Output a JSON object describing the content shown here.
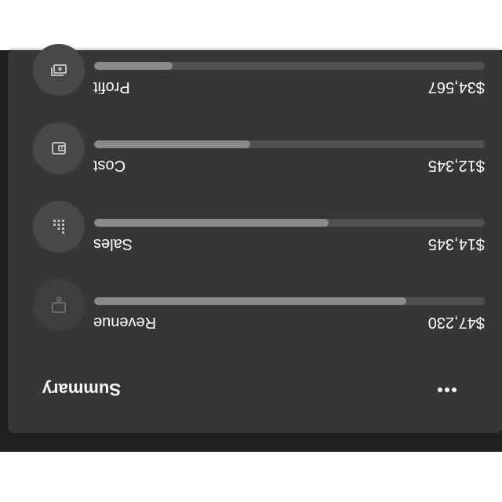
{
  "card": {
    "title": "Summary",
    "menu_icon": "more-horizontal-icon"
  },
  "metrics": [
    {
      "label": "Revenue",
      "value": "$47,230",
      "progress": 0.8,
      "icon": "receipt-icon"
    },
    {
      "label": "Sales",
      "value": "$14,345",
      "progress": 0.6,
      "icon": "bar-chart-icon"
    },
    {
      "label": "Cost",
      "value": "$12,345",
      "progress": 0.4,
      "icon": "wallet-icon"
    },
    {
      "label": "Profit",
      "value": "$34,567",
      "progress": 0.2,
      "icon": "cash-icon"
    }
  ],
  "colors": {
    "card_background": "#363636",
    "bar_track": "#505050",
    "bar_fill": "#8a8a8a",
    "icon_circle": "#484848",
    "text": "#ffffff"
  }
}
